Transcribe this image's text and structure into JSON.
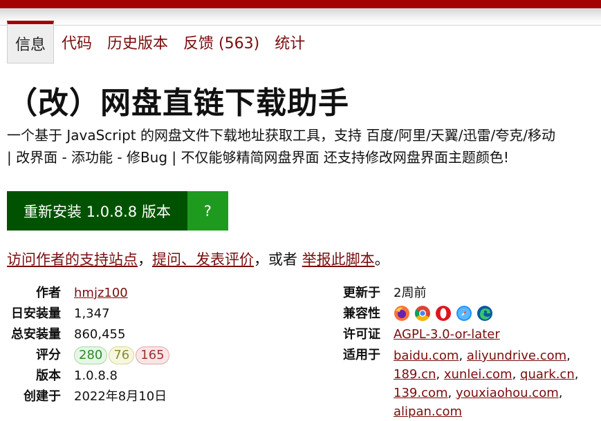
{
  "tabs": [
    {
      "label": "信息",
      "active": true
    },
    {
      "label": "代码",
      "active": false
    },
    {
      "label": "历史版本",
      "active": false
    },
    {
      "label": "反馈 (563)",
      "active": false
    },
    {
      "label": "统计",
      "active": false
    }
  ],
  "script": {
    "title": "（改）网盘直链下载助手",
    "desc_line1": "一个基于 JavaScript 的网盘文件下载地址获取工具，支持 百度/阿里/天翼/迅雷/夸克/移动",
    "desc_line2": "| 改界面 - 添功能 - 修Bug | 不仅能够精简网盘界面 还支持修改网盘界面主题颜色!"
  },
  "install": {
    "label": "重新安装 1.0.8.8 版本",
    "help": "?"
  },
  "links": {
    "support": "访问作者的支持站点",
    "sep1": "，",
    "feedback": "提问、发表评价",
    "sep2": "，或者",
    "report": "举报此脚本",
    "end": "。"
  },
  "info": {
    "author_label": "作者",
    "author": "hmjz100",
    "daily_label": "日安装量",
    "daily": "1,347",
    "total_label": "总安装量",
    "total": "860,455",
    "rating_label": "评分",
    "rating_good": "280",
    "rating_ok": "76",
    "rating_bad": "165",
    "version_label": "版本",
    "version": "1.0.8.8",
    "created_label": "创建于",
    "created": "2022年8月10日",
    "updated_label": "更新于",
    "updated": "2周前",
    "compat_label": "兼容性",
    "compat": [
      "firefox-icon",
      "chrome-icon",
      "opera-icon",
      "safari-icon",
      "edge-icon"
    ],
    "license_label": "许可证",
    "license": "AGPL-3.0-or-later",
    "applies_label": "适用于",
    "sites": [
      "baidu.com",
      "aliyundrive.com",
      "189.cn",
      "xunlei.com",
      "quark.cn",
      "139.com",
      "youxiaohou.com",
      "alipan.com"
    ]
  },
  "colors": {
    "brand": "#a50000",
    "link": "#7a0c0c",
    "install": "#005200",
    "install_help": "#1e9b1e"
  }
}
